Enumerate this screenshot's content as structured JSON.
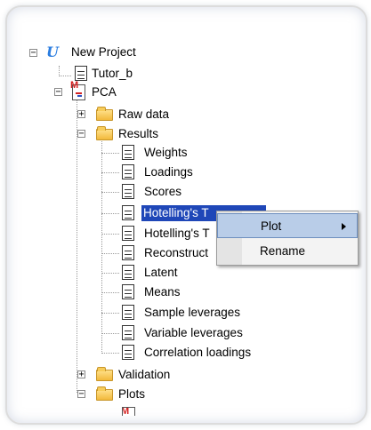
{
  "tree": {
    "project": "New Project",
    "tutor": "Tutor_b",
    "pca": "PCA",
    "raw_data": "Raw data",
    "results": "Results",
    "results_items": [
      "Weights",
      "Loadings",
      "Scores",
      "Hotelling's T",
      "Hotelling's T",
      "Reconstruct",
      "Latent",
      "Means",
      "Sample leverages",
      "Variable leverages",
      "Correlation loadings"
    ],
    "validation": "Validation",
    "plots": "Plots",
    "expand_symbol": "+",
    "collapse_symbol": "−"
  },
  "context_menu": {
    "plot": "Plot",
    "rename": "Rename"
  },
  "colors": {
    "selection": "#1f47b8",
    "menu_highlight": "#b9cde8",
    "project_icon": "#2b7de0"
  },
  "icons": {
    "project": "u-project-icon",
    "document": "document-icon",
    "folder": "folder-icon",
    "pca": "pca-model-icon"
  }
}
